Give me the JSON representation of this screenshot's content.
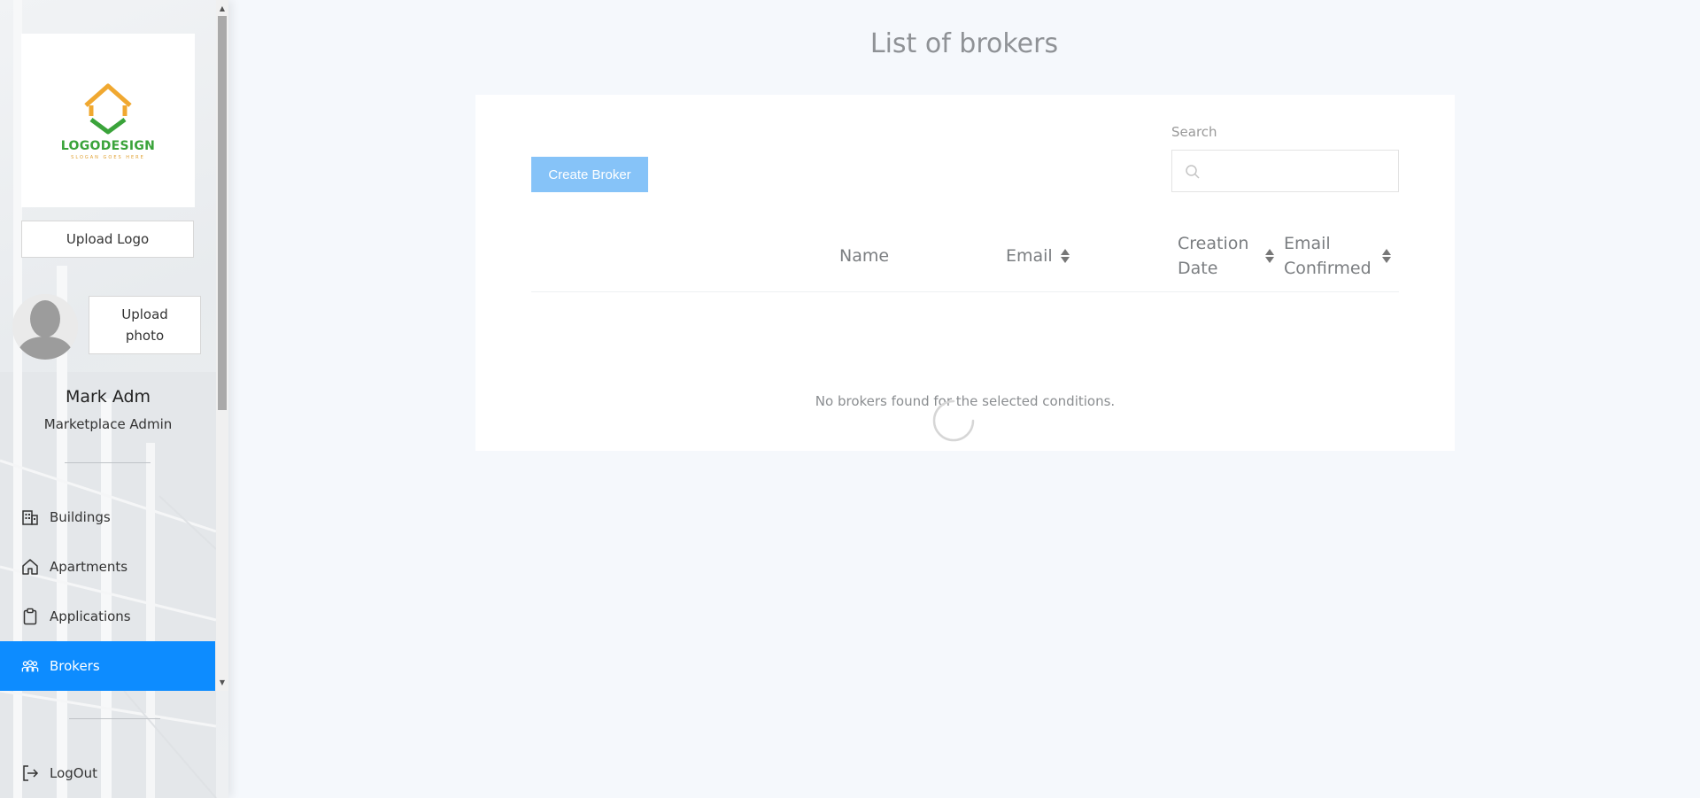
{
  "sidebar": {
    "logo": {
      "text": "LOGODESIGN",
      "slogan": "SLOGAN GOES HERE"
    },
    "upload_logo_label": "Upload Logo",
    "upload_photo_label": "Upload photo",
    "user": {
      "name": "Mark Adm",
      "role": "Marketplace Admin"
    },
    "nav": {
      "buildings": {
        "label": "Buildings",
        "icon": "building-icon"
      },
      "apartments": {
        "label": "Apartments",
        "icon": "home-icon"
      },
      "applications": {
        "label": "Applications",
        "icon": "clipboard-icon"
      },
      "brokers": {
        "label": "Brokers",
        "icon": "people-icon",
        "active": true
      }
    },
    "logout_label": "LogOut"
  },
  "main": {
    "title": "List of brokers",
    "create_button_label": "Create Broker",
    "search": {
      "label": "Search",
      "value": ""
    },
    "table": {
      "columns": {
        "name": "Name",
        "email": "Email",
        "creation_date": "Creation Date",
        "email_confirmed": "Email Confirmed"
      },
      "rows": [],
      "empty_message": "No brokers found for the selected conditions."
    }
  },
  "colors": {
    "accent": "#0d8cff",
    "create_button": "#86c3f8",
    "logo_orange": "#f0a830",
    "logo_green": "#3aa33a"
  }
}
